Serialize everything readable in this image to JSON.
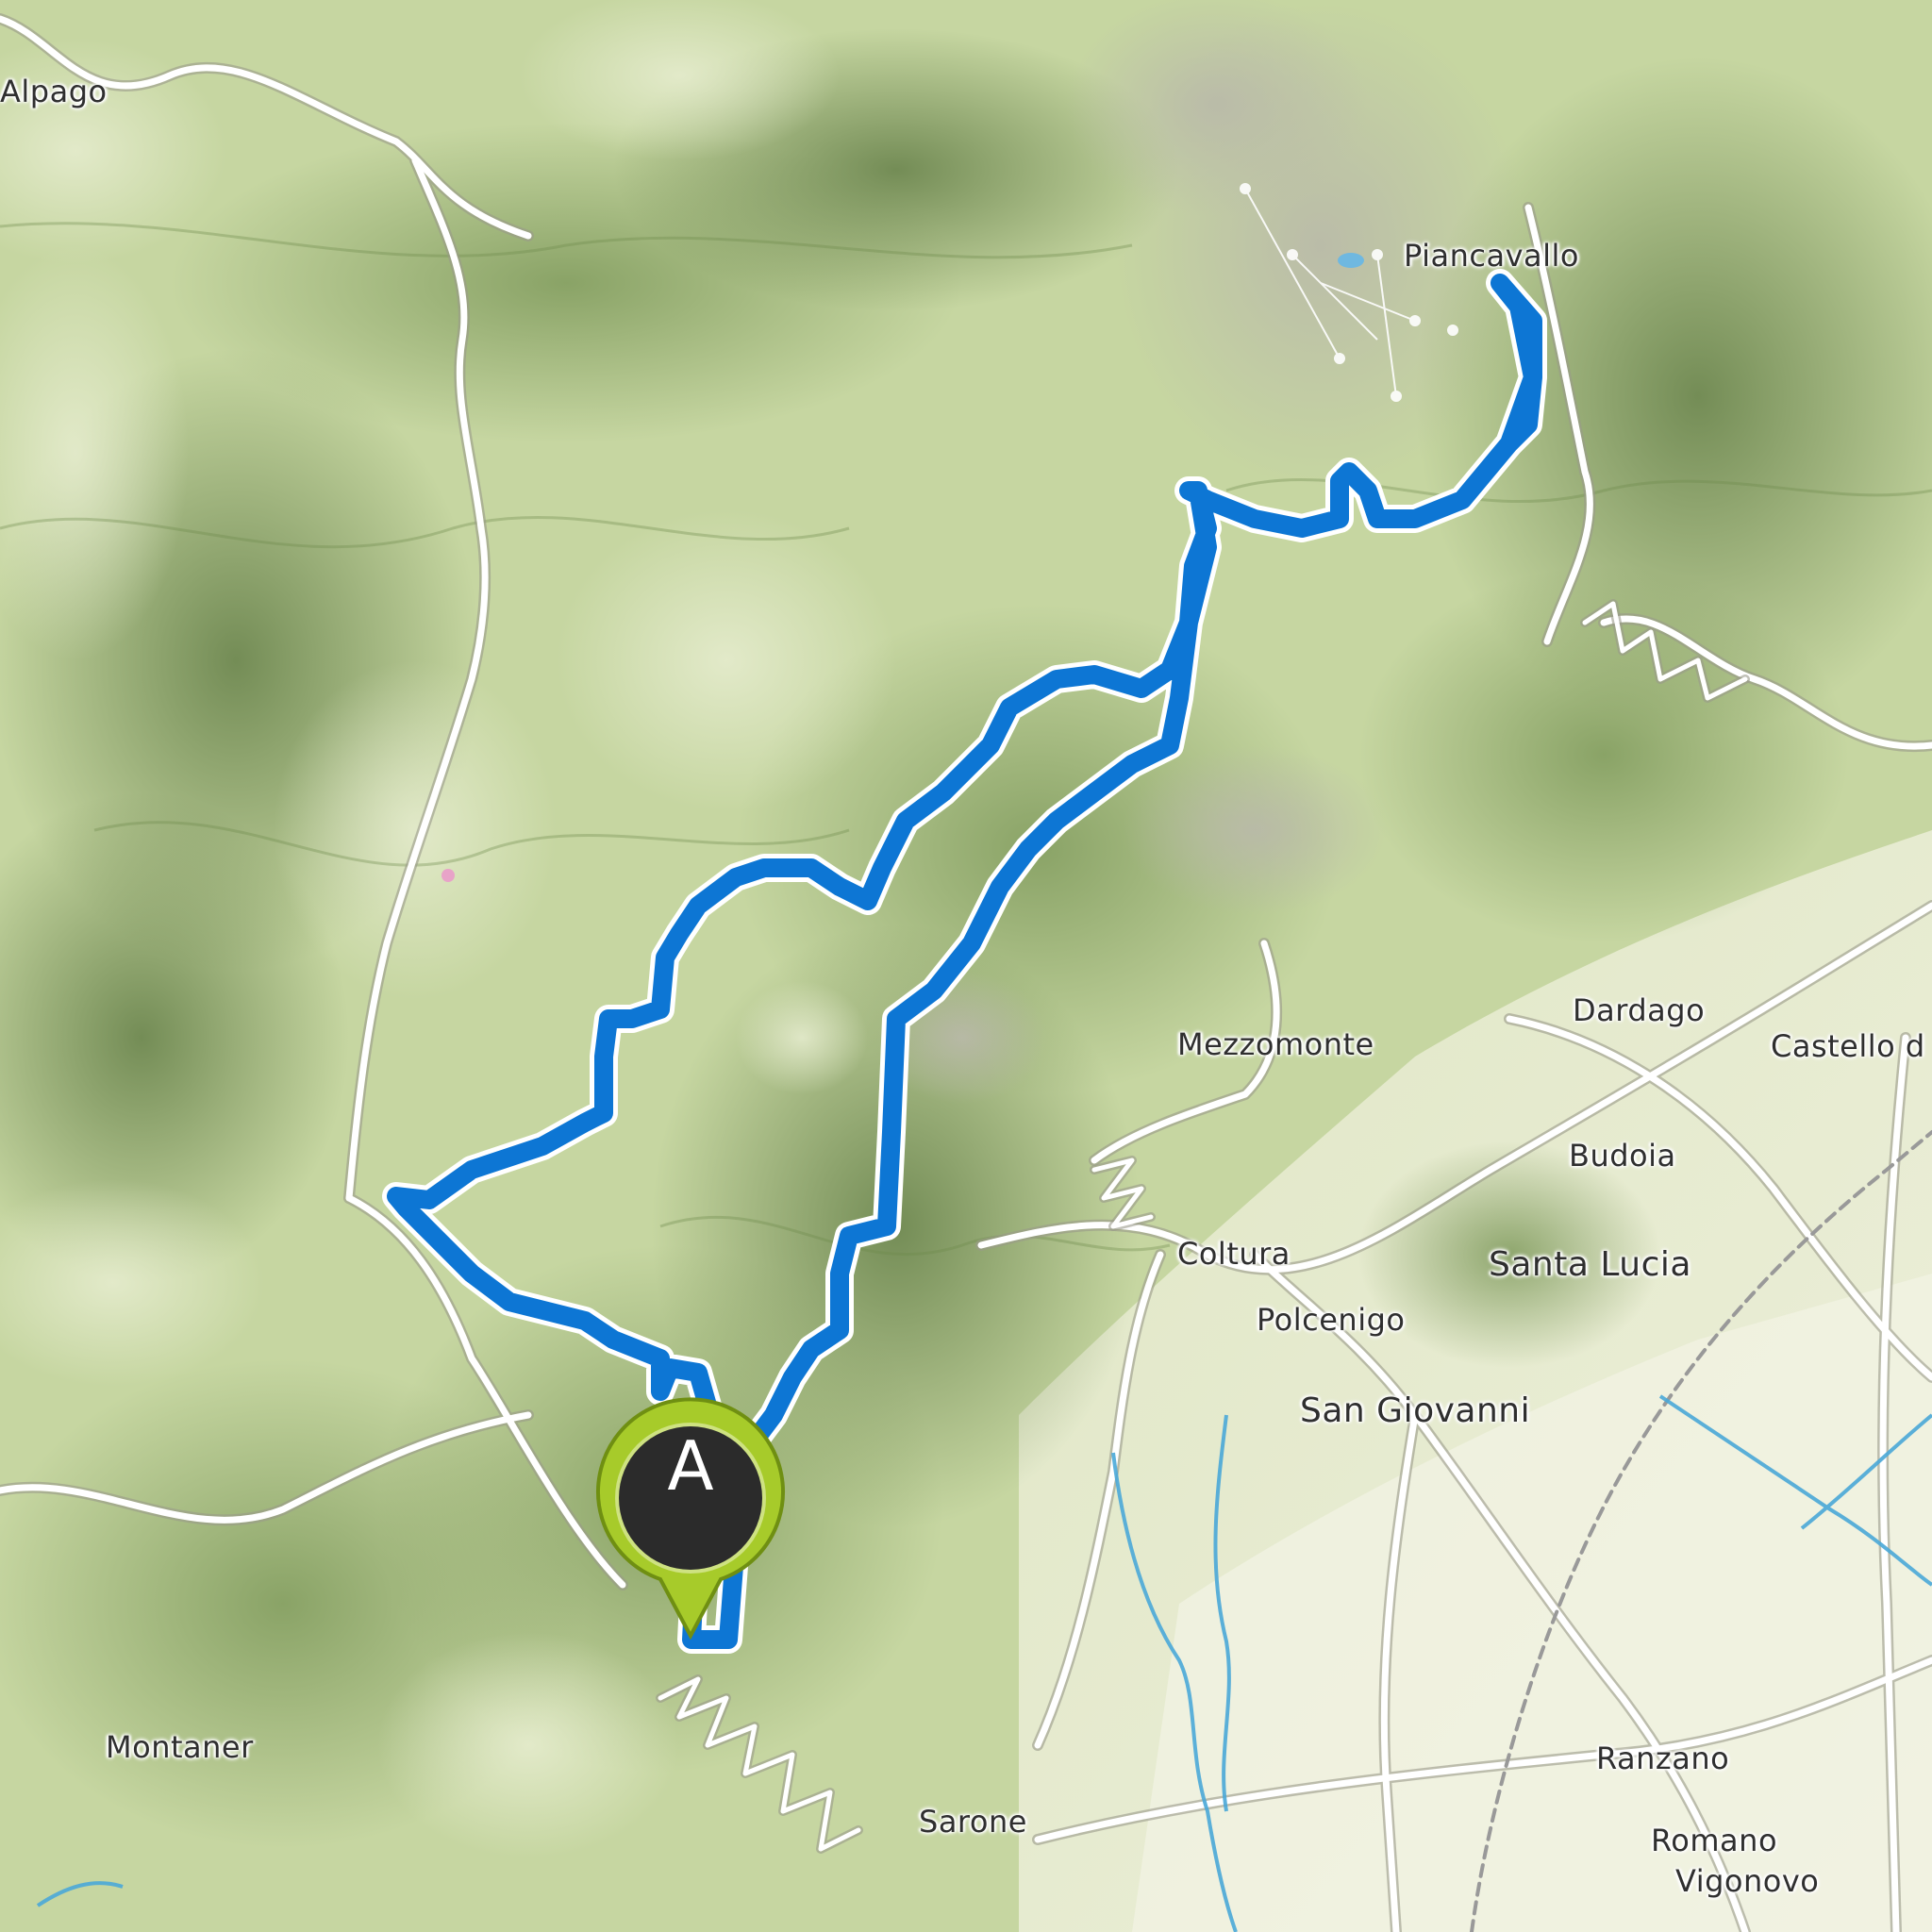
{
  "map": {
    "type": "topographic route map",
    "route_color": "#0d76d4",
    "marker_color": "#a7cb2a",
    "marker_inner_color": "#2b2b2b",
    "water_color": "#4aa8d8"
  },
  "places": {
    "alpago": "Alpago",
    "piancavallo": "Piancavallo",
    "dardago": "Dardago",
    "castello": "Castello d",
    "mezzomonte": "Mezzomonte",
    "budoia": "Budoia",
    "coltura": "Coltura",
    "santa_lucia": "Santa Lucia",
    "polcenigo": "Polcenigo",
    "san_giovanni": "San Giovanni",
    "montaner": "Montaner",
    "sarone": "Sarone",
    "ranzano": "Ranzano",
    "romano": "Romano",
    "vigonovo": "Vigonovo"
  },
  "marker": {
    "letter": "A",
    "icon": "map-pin-icon"
  }
}
